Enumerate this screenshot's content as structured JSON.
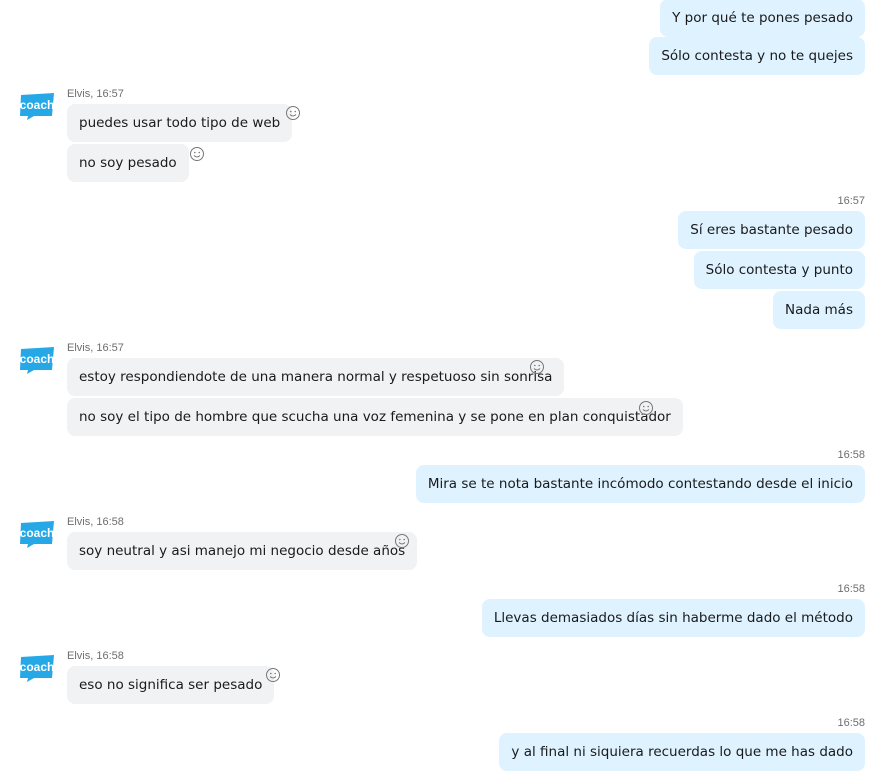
{
  "theme": {
    "outgoing_bubble": "#dff2ff",
    "incoming_bubble": "#f1f2f4",
    "avatar_color": "#26a8e6"
  },
  "avatar": {
    "text": "coach",
    "icon": "coach-logo"
  },
  "messages": [
    {
      "dir": "out",
      "text": "Y por qué te pones pesado"
    },
    {
      "dir": "out",
      "text": "Sólo contesta y no te quejes"
    },
    {
      "dir": "in",
      "sender": "Elvis, 16:57",
      "text": "puedes usar todo tipo de web"
    },
    {
      "dir": "in",
      "text": "no soy pesado"
    },
    {
      "dir": "out",
      "time": "16:57",
      "text": "Sí eres bastante pesado"
    },
    {
      "dir": "out",
      "text": "Sólo contesta y punto"
    },
    {
      "dir": "out",
      "text": "Nada más"
    },
    {
      "dir": "in",
      "sender": "Elvis, 16:57",
      "text": "estoy respondiendote de una manera normal y respetuoso sin sonrisa"
    },
    {
      "dir": "in",
      "text": "no soy el tipo de hombre que scucha una voz femenina y se pone en plan conquistador"
    },
    {
      "dir": "out",
      "time": "16:58",
      "text": "Mira se te nota bastante incómodo contestando desde el inicio"
    },
    {
      "dir": "in",
      "sender": "Elvis, 16:58",
      "text": "soy neutral y asi manejo mi negocio desde años"
    },
    {
      "dir": "out",
      "time": "16:58",
      "text": "Llevas demasiados días sin haberme dado el método"
    },
    {
      "dir": "in",
      "sender": "Elvis, 16:58",
      "text": "eso no significa ser pesado"
    },
    {
      "dir": "out",
      "time": "16:58",
      "text": "y al final ni siquiera recuerdas lo que me has dado"
    }
  ]
}
